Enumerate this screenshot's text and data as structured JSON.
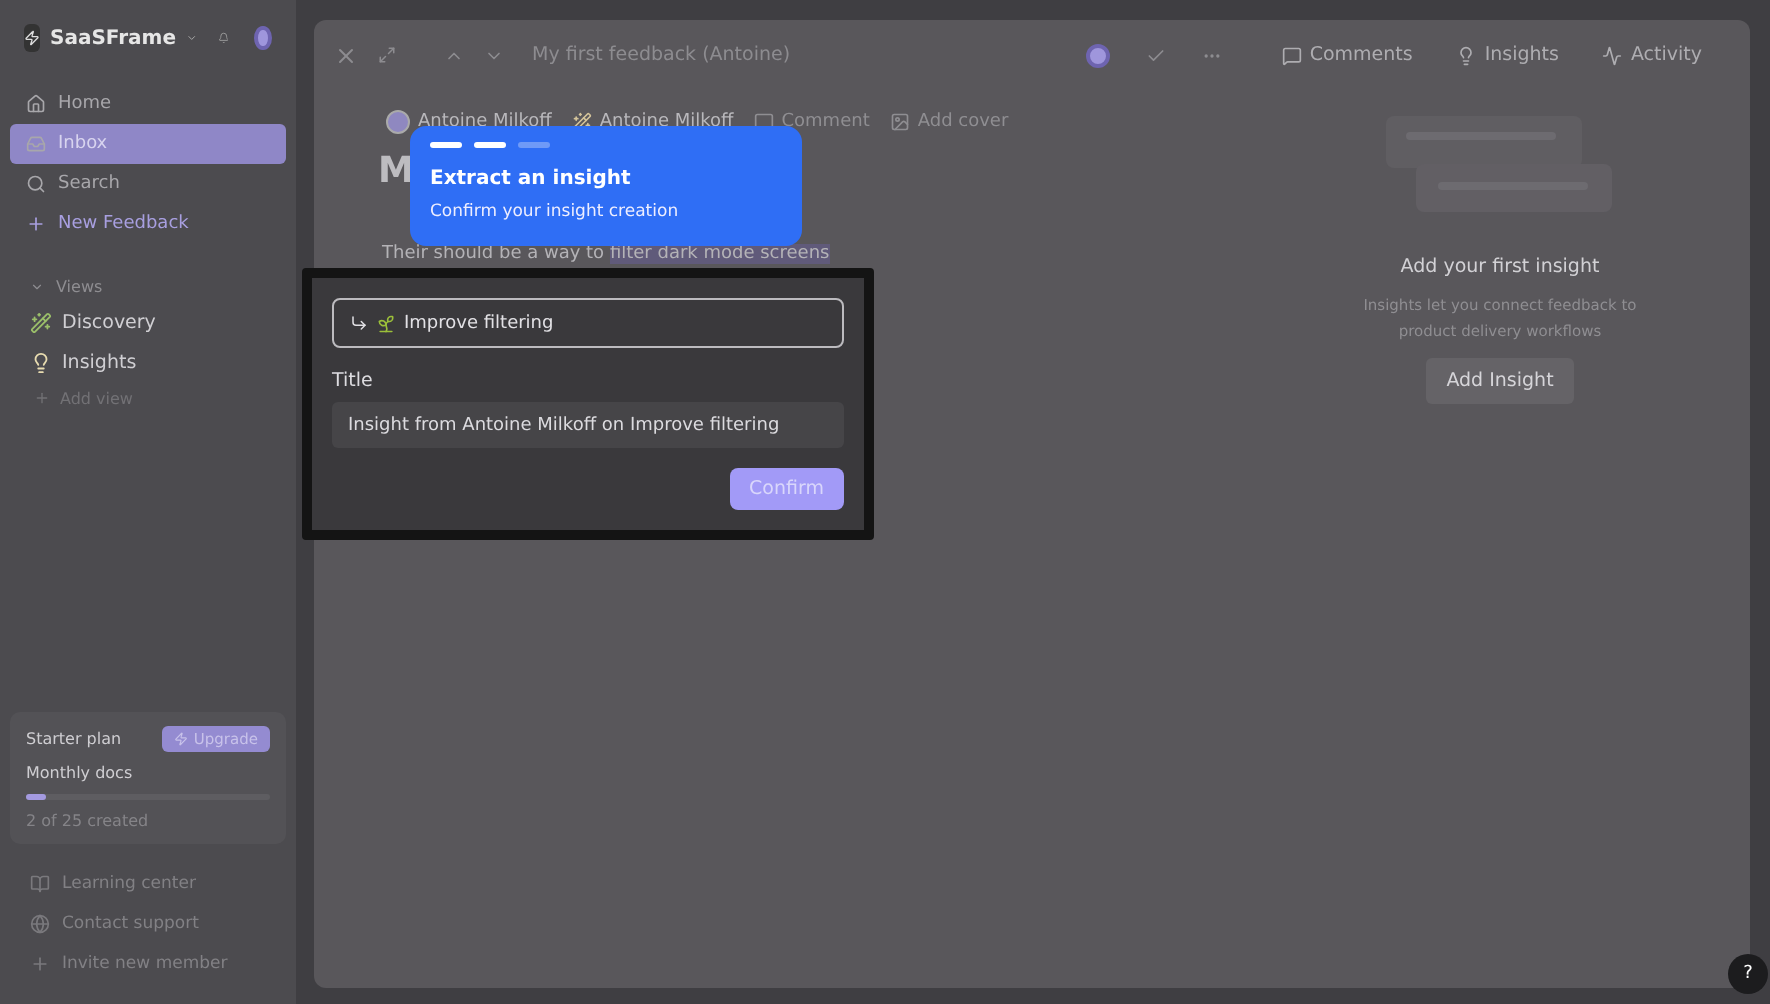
{
  "workspace": {
    "name": "SaaSFrame"
  },
  "sidebar": {
    "items": [
      {
        "label": "Home",
        "selected": false,
        "kind": "nav"
      },
      {
        "label": "Inbox",
        "selected": true,
        "kind": "nav"
      },
      {
        "label": "Search",
        "selected": false,
        "kind": "nav"
      },
      {
        "label": "New Feedback",
        "selected": false,
        "kind": "action"
      }
    ],
    "views_label": "Views",
    "views": [
      {
        "label": "Discovery"
      },
      {
        "label": "Insights"
      }
    ],
    "add_view": "Add view",
    "plan": {
      "name": "Starter plan",
      "upgrade": "Upgrade",
      "metric": "Monthly docs",
      "level": 0.08,
      "usage": "2 of 25 created"
    },
    "footer": [
      {
        "label": "Learning center"
      },
      {
        "label": "Contact support"
      },
      {
        "label": "Invite new member"
      }
    ]
  },
  "feedback": {
    "title": "My first feedback (Antoine)",
    "tabs": [
      {
        "label": "Comments"
      },
      {
        "label": "Insights"
      },
      {
        "label": "Activity"
      }
    ],
    "meta": [
      {
        "label": "Antoine Milkoff"
      },
      {
        "label": "Antoine Milkoff"
      },
      {
        "label": "Comment"
      },
      {
        "label": "Add cover"
      }
    ],
    "heading": "M",
    "body": "Their should be a way to ",
    "highlight": "filter dark mode screens"
  },
  "insights_panel": {
    "title": "Add your first insight",
    "description": "Insights let you connect feedback to product delivery workflows",
    "button": "Add Insight"
  },
  "tour": {
    "steps": [
      {
        "done": true
      },
      {
        "done": true
      },
      {
        "done": false
      }
    ],
    "title": "Extract an insight",
    "text": "Confirm your insight creation"
  },
  "dialog": {
    "target": "Improve filtering",
    "title_label": "Title",
    "title_value": "Insight from Antoine Milkoff on Improve filtering",
    "confirm": "Confirm"
  },
  "help": "?"
}
